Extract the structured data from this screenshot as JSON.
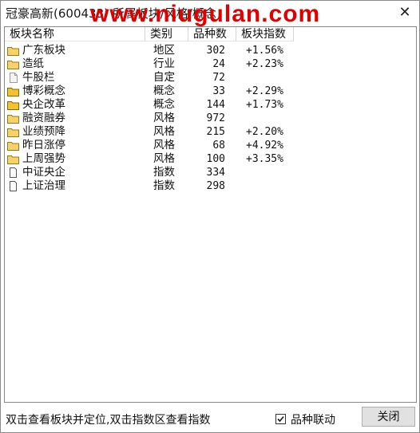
{
  "window": {
    "title": "冠豪高新(600433) 所属板块/风格/概念",
    "watermark": "www.niugulan.com",
    "close_glyph": "✕"
  },
  "table": {
    "headers": [
      "板块名称",
      "类别",
      "品种数",
      "板块指数"
    ],
    "rows": [
      {
        "icon": "folder-icon",
        "name": "广东板块",
        "type": "地区",
        "count": "302",
        "index": "+1.56%"
      },
      {
        "icon": "folder-icon",
        "name": "造纸",
        "type": "行业",
        "count": "24",
        "index": "+2.23%"
      },
      {
        "icon": "document-icon",
        "name": "牛股栏",
        "type": "自定",
        "count": "72",
        "index": ""
      },
      {
        "icon": "folder-filled-icon",
        "name": "博彩概念",
        "type": "概念",
        "count": "33",
        "index": "+2.29%"
      },
      {
        "icon": "folder-filled-icon",
        "name": "央企改革",
        "type": "概念",
        "count": "144",
        "index": "+1.73%"
      },
      {
        "icon": "folder-icon",
        "name": "融资融券",
        "type": "风格",
        "count": "972",
        "index": ""
      },
      {
        "icon": "folder-icon",
        "name": "业绩预降",
        "type": "风格",
        "count": "215",
        "index": "+2.20%"
      },
      {
        "icon": "folder-icon",
        "name": "昨日涨停",
        "type": "风格",
        "count": "68",
        "index": "+4.92%"
      },
      {
        "icon": "folder-icon",
        "name": "上周强势",
        "type": "风格",
        "count": "100",
        "index": "+3.35%"
      },
      {
        "icon": "page-icon",
        "name": "中证央企",
        "type": "指数",
        "count": "334",
        "index": ""
      },
      {
        "icon": "page-icon",
        "name": "上证治理",
        "type": "指数",
        "count": "298",
        "index": ""
      }
    ]
  },
  "status": {
    "hint": "双击查看板块并定位,双击指数区查看指数",
    "link_label": "品种联动",
    "link_checked": true,
    "close_label": "关闭"
  },
  "colors": {
    "folder": "#f5d26a",
    "folder_filled": "#f2c230",
    "watermark": "#e00000"
  }
}
